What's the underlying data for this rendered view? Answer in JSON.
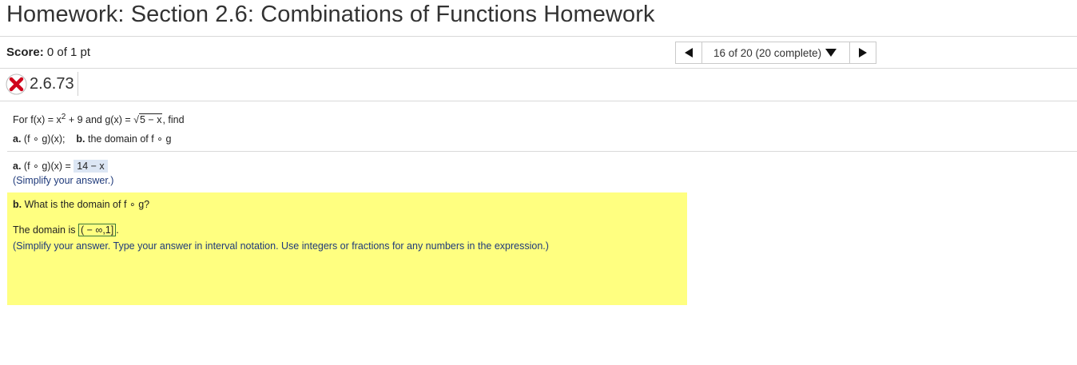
{
  "page": {
    "title": "Homework: Section 2.6: Combinations of Functions Homework"
  },
  "score": {
    "label": "Score:",
    "value": "0 of 1 pt"
  },
  "nav": {
    "progress": "16 of 20 (20 complete)"
  },
  "question": {
    "number": "2.6.73",
    "status_icon": "incorrect-x-icon",
    "prompt_prefix": "For f(x) = x",
    "prompt_exp": "2",
    "prompt_mid": " + 9 and g(x) = ",
    "prompt_sqrt_sym": "√",
    "prompt_sqrt_arg": "5 − x",
    "prompt_suffix": ", find",
    "part_a_label": "a.",
    "part_a_text": "(f ∘ g)(x);",
    "part_b_label": "b.",
    "part_b_text": "the domain of f ∘ g"
  },
  "answer_a": {
    "label": "a.",
    "expr": "(f ∘ g)(x) =",
    "value": "14 − x",
    "hint": "(Simplify your answer.)"
  },
  "answer_b": {
    "label": "b.",
    "question": "What is the domain of f ∘ g?",
    "domain_prefix": "The domain is",
    "value": "( − ∞,1]",
    "domain_suffix": ".",
    "hint": "(Simplify your answer. Type your answer in interval notation. Use integers or fractions for any numbers in the expression.)"
  },
  "colors": {
    "highlight": "#ffff80",
    "answer_bg": "#dce6f4",
    "incorrect": "#d0021b"
  }
}
